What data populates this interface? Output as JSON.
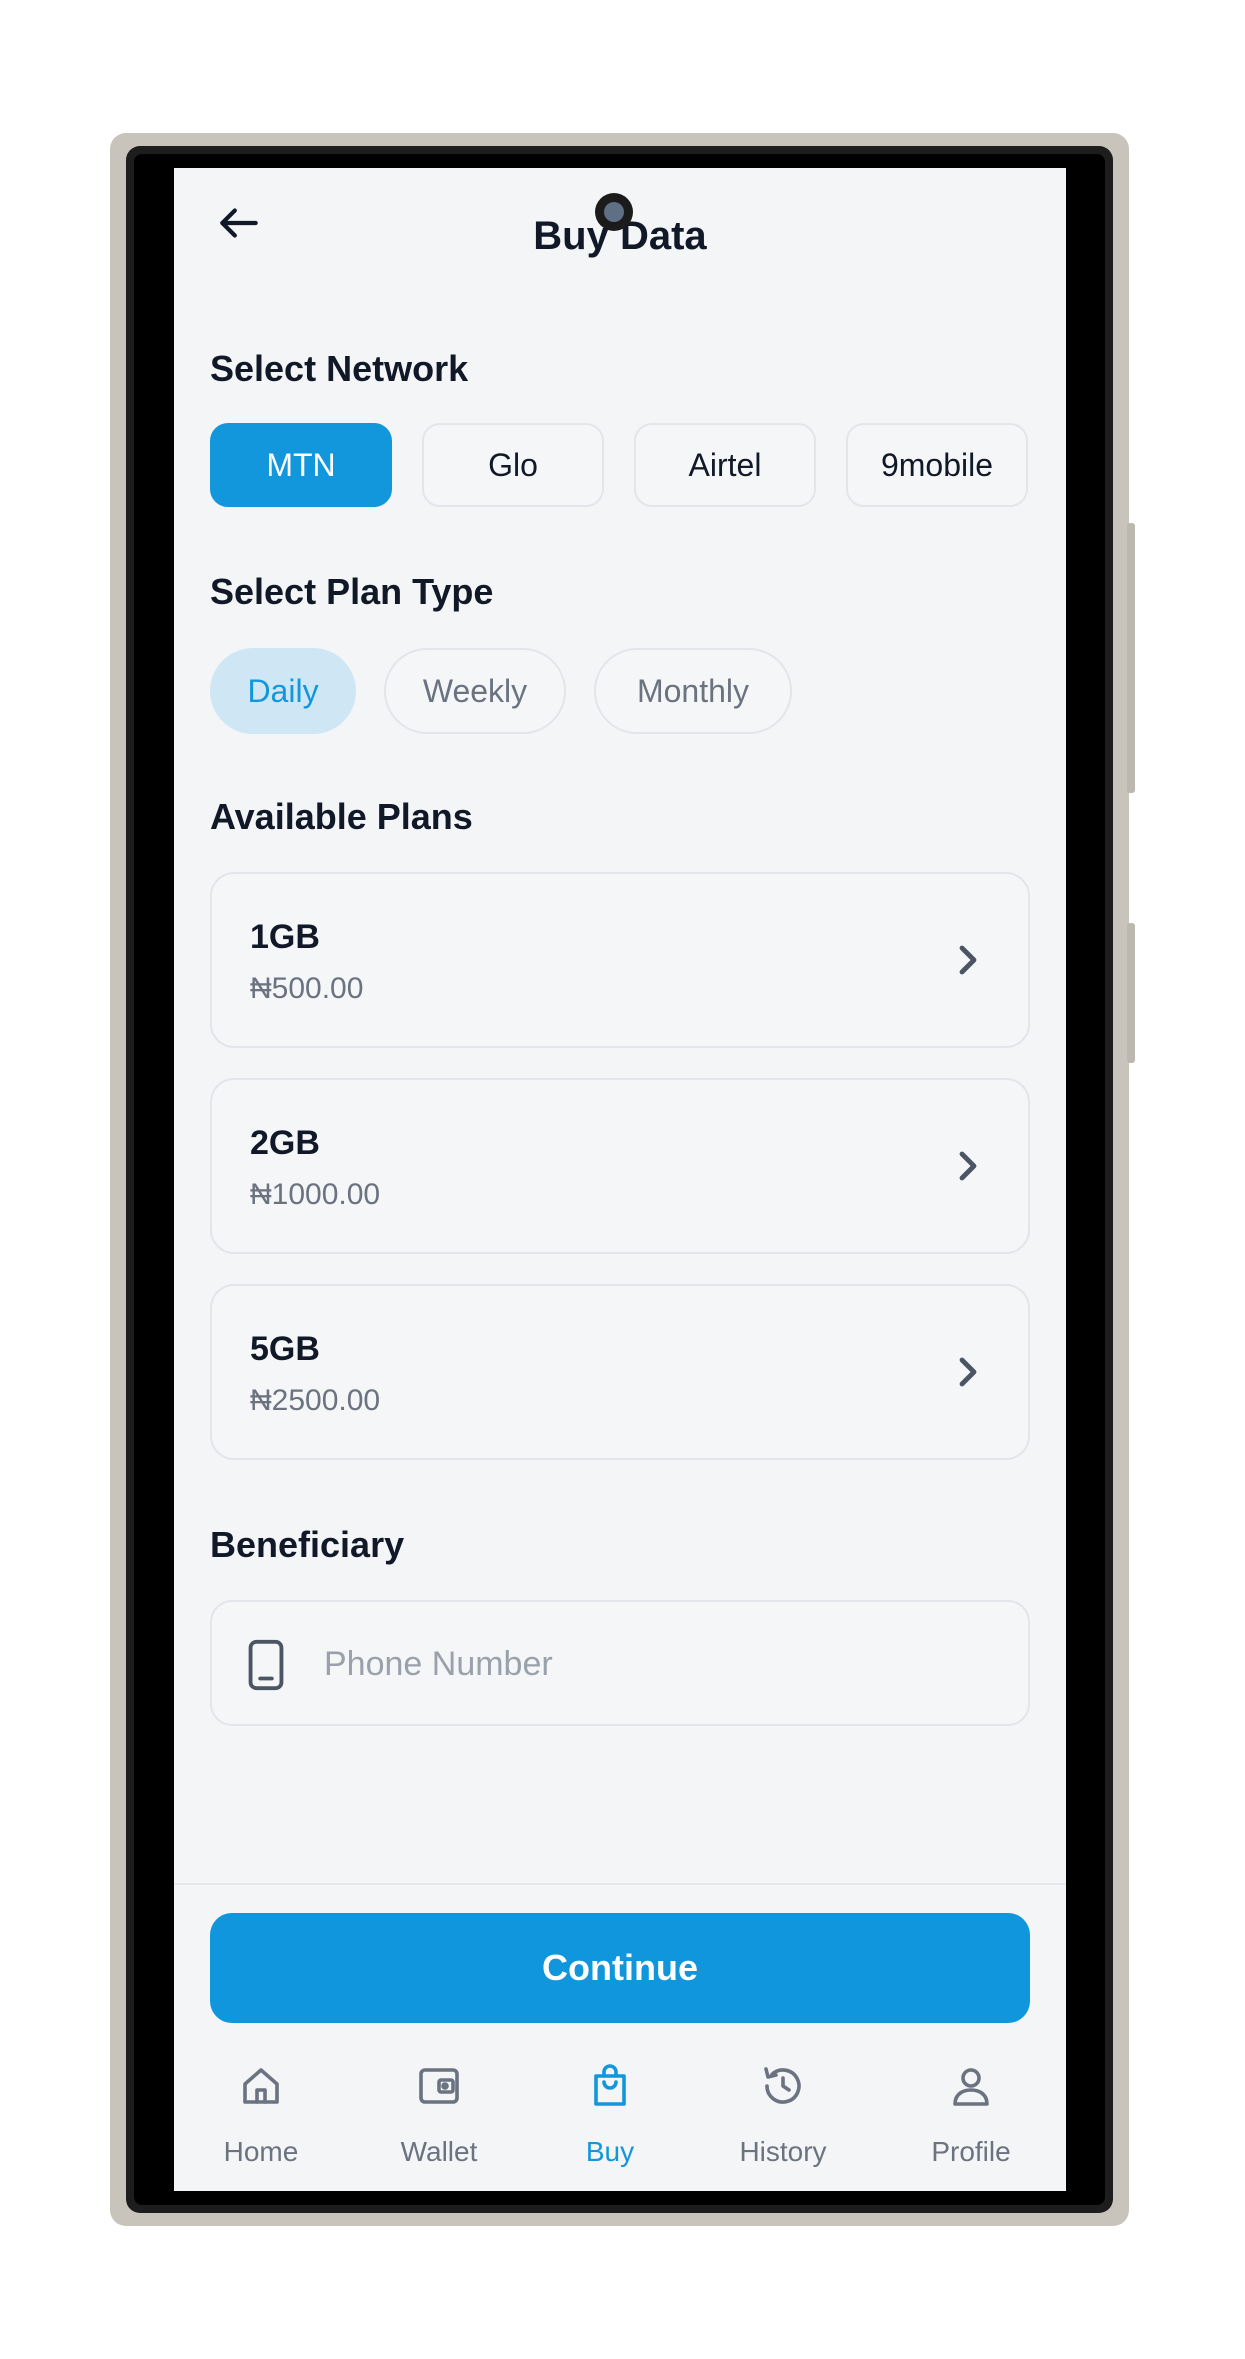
{
  "header": {
    "title": "Buy Data",
    "back_icon": "arrow-left-icon"
  },
  "network": {
    "section_title": "Select Network",
    "options": [
      "MTN",
      "Glo",
      "Airtel",
      "9mobile"
    ],
    "selected": "MTN"
  },
  "plan_type": {
    "section_title": "Select Plan Type",
    "options": [
      "Daily",
      "Weekly",
      "Monthly"
    ],
    "selected": "Daily"
  },
  "plans": {
    "section_title": "Available Plans",
    "items": [
      {
        "size": "1GB",
        "price": "₦500.00"
      },
      {
        "size": "2GB",
        "price": "₦1000.00"
      },
      {
        "size": "5GB",
        "price": "₦2500.00"
      }
    ]
  },
  "beneficiary": {
    "section_title": "Beneficiary",
    "phone_placeholder": "Phone Number",
    "phone_value": "",
    "icon": "smartphone-icon"
  },
  "actions": {
    "continue_label": "Continue"
  },
  "bottom_nav": {
    "items": [
      {
        "label": "Home",
        "icon": "home-icon"
      },
      {
        "label": "Wallet",
        "icon": "wallet-icon"
      },
      {
        "label": "Buy",
        "icon": "shopping-bag-icon"
      },
      {
        "label": "History",
        "icon": "history-icon"
      },
      {
        "label": "Profile",
        "icon": "user-icon"
      }
    ],
    "active": "Buy"
  },
  "colors": {
    "accent": "#1296dc",
    "accent_light": "#cfe7f4",
    "background": "#f3f5f7",
    "text_primary": "#111827",
    "text_secondary": "#6b7280"
  }
}
